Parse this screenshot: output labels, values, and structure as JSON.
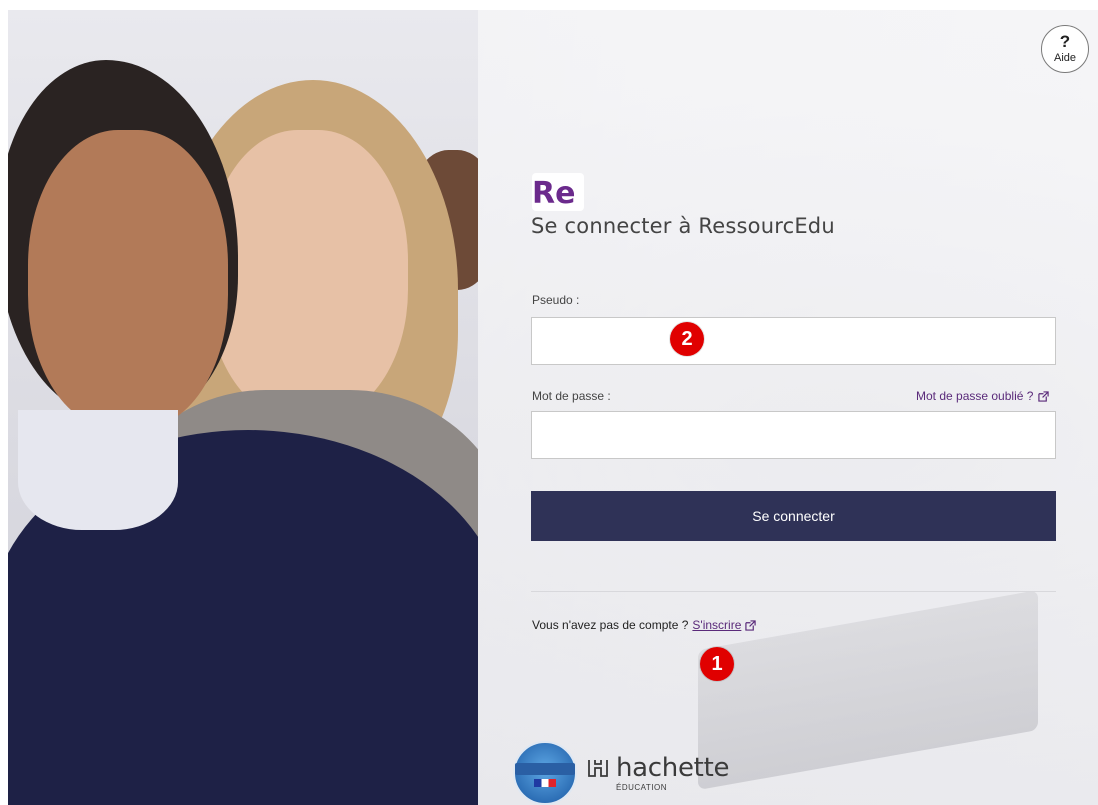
{
  "header": {
    "help": {
      "symbol": "?",
      "label": "Aide"
    }
  },
  "logo": {
    "text": "Re",
    "color": "#6b2a8c"
  },
  "title": "Se connecter à RessourcEdu",
  "form": {
    "pseudo_label": "Pseudo :",
    "pseudo_value": "",
    "password_label": "Mot de passe :",
    "password_value": "",
    "forgot_label": "Mot de passe oublié ?",
    "submit_label": "Se connecter"
  },
  "register": {
    "prompt": "Vous n'avez pas de compte ?",
    "link_label": "S'inscrire"
  },
  "annotations": [
    {
      "number": "2"
    },
    {
      "number": "1"
    }
  ],
  "footer": {
    "seal": {
      "line1": "RESSOURCE",
      "line2": "NUMÉRIQUE"
    },
    "brand": {
      "name": "hachette",
      "sub": "ÉDUCATION"
    }
  },
  "colors": {
    "accent_purple": "#5a2a7a",
    "button_bg": "#2f3257",
    "badge_red": "#e00000"
  }
}
